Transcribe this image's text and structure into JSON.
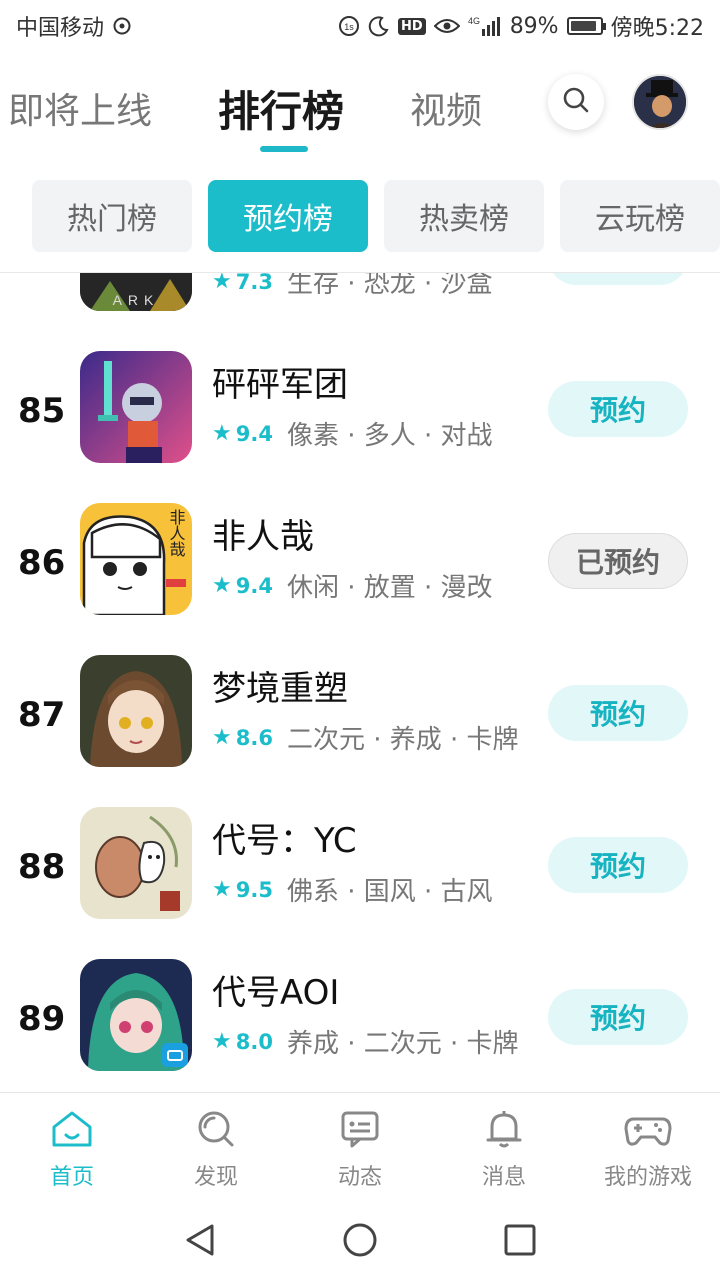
{
  "status_bar": {
    "carrier": "中国移动",
    "network": "4G",
    "battery_percent": "89%",
    "battery_level": 0.89,
    "time": "傍晚5:22",
    "hd_label": "HD"
  },
  "header": {
    "tabs": [
      {
        "label": "即将上线",
        "active": false
      },
      {
        "label": "排行榜",
        "active": true
      },
      {
        "label": "视频",
        "active": false
      }
    ],
    "search_icon": "search-icon",
    "avatar": "user-avatar"
  },
  "sub_tabs": [
    {
      "label": "热门榜",
      "active": false
    },
    {
      "label": "预约榜",
      "active": true
    },
    {
      "label": "热卖榜",
      "active": false
    },
    {
      "label": "云玩榜",
      "active": false
    }
  ],
  "games": [
    {
      "rank": "",
      "name": "",
      "score": "7.3",
      "tags": "生存 · 恐龙 · 沙盒",
      "button": "",
      "icon_logo": "ARK",
      "partial": true
    },
    {
      "rank": "85",
      "name": "砰砰军团",
      "score": "9.4",
      "tags": "像素 · 多人 · 对战",
      "button": "预约",
      "reserved": false
    },
    {
      "rank": "86",
      "name": "非人哉",
      "score": "9.4",
      "tags": "休闲 · 放置 · 漫改",
      "button": "已预约",
      "reserved": true,
      "icon_logo": "非人哉"
    },
    {
      "rank": "87",
      "name": "梦境重塑",
      "score": "8.6",
      "tags": "二次元 · 养成 · 卡牌",
      "button": "预约",
      "reserved": false
    },
    {
      "rank": "88",
      "name": "代号：YC",
      "score": "9.5",
      "tags": "佛系 · 国风 · 古风",
      "button": "预约",
      "reserved": false
    },
    {
      "rank": "89",
      "name": "代号AOI",
      "score": "8.0",
      "tags": "养成 · 二次元 · 卡牌",
      "button": "预约",
      "reserved": false
    }
  ],
  "bottom_nav": [
    {
      "label": "首页",
      "icon": "home-icon",
      "active": true
    },
    {
      "label": "发现",
      "icon": "discover-icon",
      "active": false
    },
    {
      "label": "动态",
      "icon": "feed-icon",
      "active": false
    },
    {
      "label": "消息",
      "icon": "bell-icon",
      "active": false
    },
    {
      "label": "我的游戏",
      "icon": "gamepad-icon",
      "active": false
    }
  ],
  "system_nav": [
    "back-icon",
    "home-circle-icon",
    "recents-icon"
  ],
  "colors": {
    "accent": "#1cbdca",
    "accent_light": "#e2f7f8",
    "text": "#111111",
    "muted": "#777777"
  }
}
